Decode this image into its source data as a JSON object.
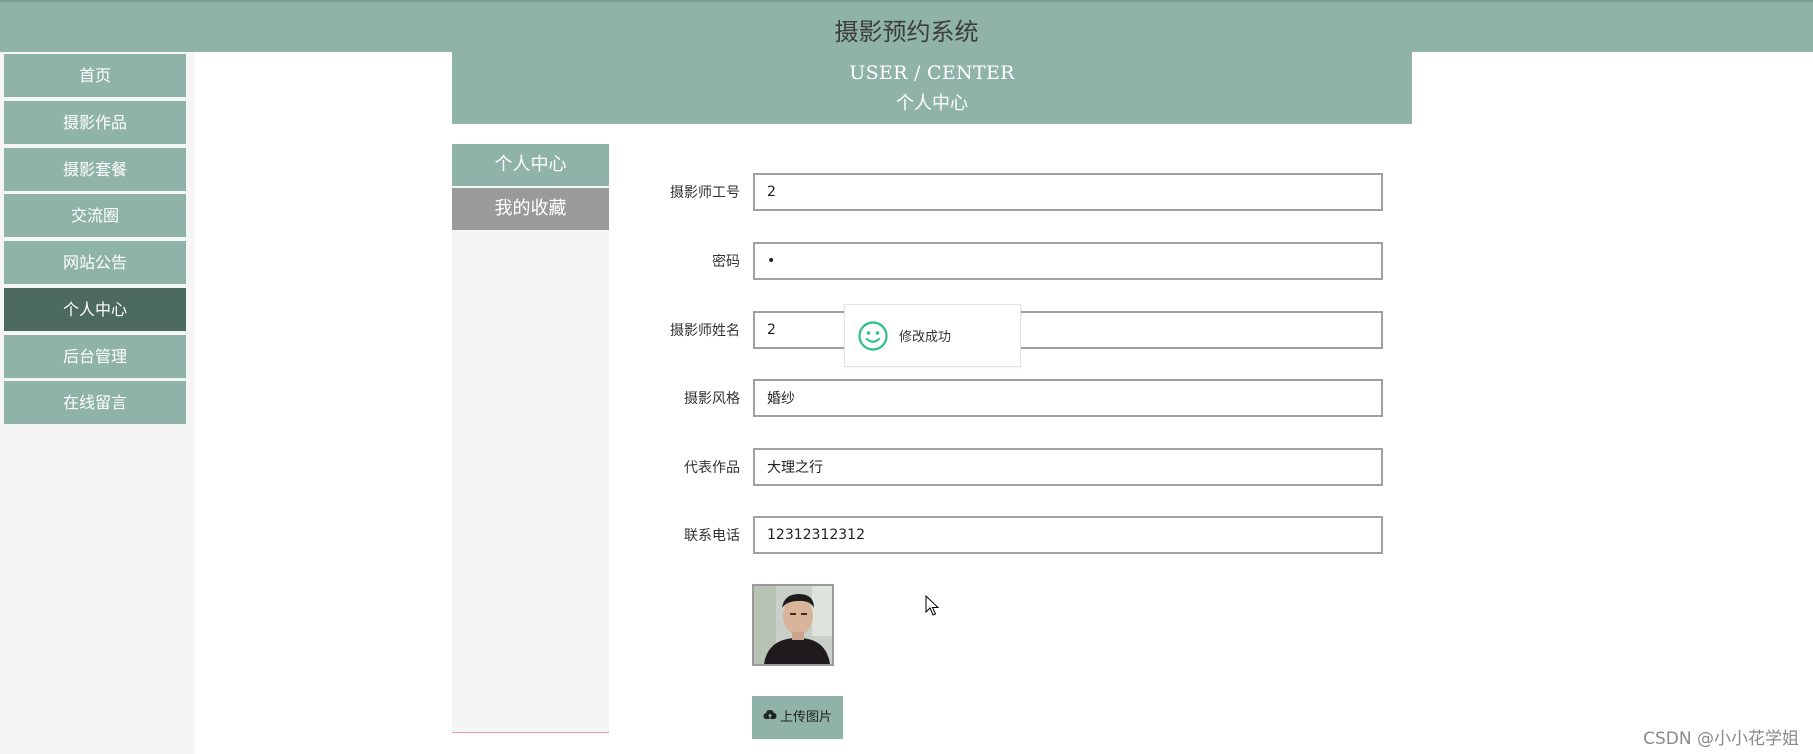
{
  "app": {
    "title": "摄影预约系统"
  },
  "nav": {
    "items": [
      {
        "label": "首页"
      },
      {
        "label": "摄影作品"
      },
      {
        "label": "摄影套餐"
      },
      {
        "label": "交流圈"
      },
      {
        "label": "网站公告"
      },
      {
        "label": "个人中心",
        "active": true
      },
      {
        "label": "后台管理"
      },
      {
        "label": "在线留言"
      }
    ]
  },
  "header": {
    "en_title": "USER / CENTER",
    "cn_title": "个人中心"
  },
  "subnav": {
    "items": [
      {
        "label": "个人中心"
      },
      {
        "label": "我的收藏"
      }
    ]
  },
  "form": {
    "fields": [
      {
        "label": "摄影师工号",
        "value": "2"
      },
      {
        "label": "密码",
        "value": "•"
      },
      {
        "label": "摄影师姓名",
        "value": "2"
      },
      {
        "label": "摄影风格",
        "value": "婚纱"
      },
      {
        "label": "代表作品",
        "value": "大理之行"
      },
      {
        "label": "联系电话",
        "value": "12312312312"
      }
    ],
    "upload_label": "上传图片"
  },
  "toast": {
    "message": "修改成功",
    "icon": "smile-icon"
  },
  "watermark": {
    "text": "CSDN @小小花学姐"
  },
  "colors": {
    "accent": "#8fb3a8",
    "nav_active": "#4c6a60",
    "subnav_secondary": "#9a9a9a",
    "toast_icon": "#2fbf8a"
  }
}
